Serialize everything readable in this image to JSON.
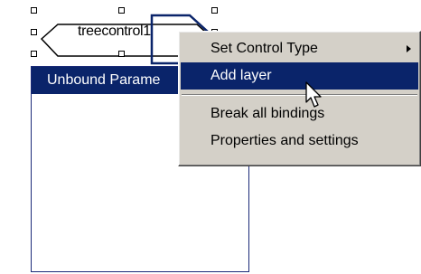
{
  "node": {
    "label": "treecontrol1"
  },
  "panel": {
    "title": "Unbound Parame"
  },
  "context_menu": {
    "items": [
      {
        "label": "Set Control Type",
        "has_submenu": true,
        "highlighted": false
      },
      {
        "label": "Add layer",
        "has_submenu": false,
        "highlighted": true
      },
      {
        "label": "Break all bindings",
        "has_submenu": false,
        "highlighted": false
      },
      {
        "label": "Properties and settings",
        "has_submenu": false,
        "highlighted": false
      }
    ]
  },
  "colors": {
    "selection_blue": "#0a246a",
    "menu_face": "#d4d0c8",
    "node_outline": "#000000"
  },
  "icons": {
    "cursor": "mouse-pointer-icon",
    "submenu": "triangle-right-icon"
  }
}
